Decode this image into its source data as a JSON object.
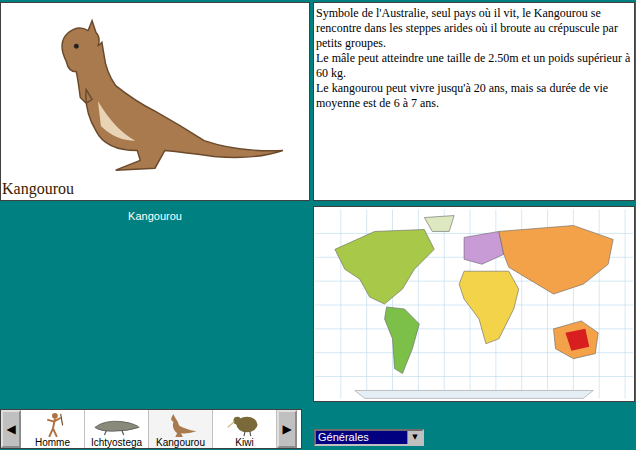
{
  "animal": {
    "caption": "Kangourou",
    "label": "Kangourou"
  },
  "description": [
    "Symbole de l'Australie, seul pays où il vit, le Kangourou se rencontre dans les steppes arides où il broute au crépuscule par petits groupes.",
    "Le mâle peut atteindre une taille de 2.50m et un poids supérieur à 60 kg.",
    "Le kangourou peut vivre jusqu'à 20 ans, mais sa durée de vie moyenne est de 6 à 7 ans."
  ],
  "scroll": {
    "left": "◀",
    "right": "▶"
  },
  "thumbnails": [
    {
      "label": "Homme",
      "selected": false,
      "kind": "human"
    },
    {
      "label": "Ichtyostega",
      "selected": false,
      "kind": "amphibian"
    },
    {
      "label": "Kangourou",
      "selected": true,
      "kind": "kangaroo"
    },
    {
      "label": "Kiwi",
      "selected": false,
      "kind": "kiwi"
    }
  ],
  "category": {
    "value": "Générales",
    "arrow": "▼",
    "focused": true
  }
}
